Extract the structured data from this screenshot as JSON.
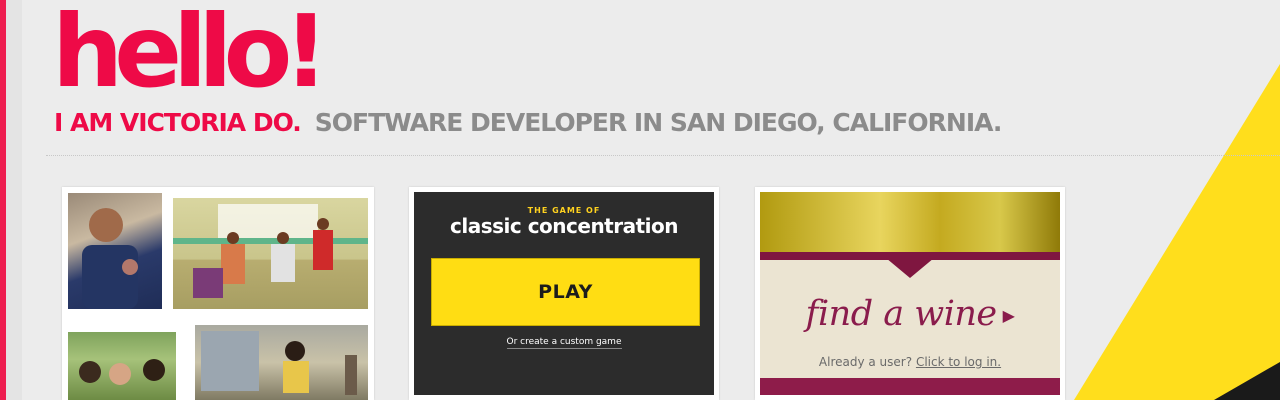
{
  "header": {
    "greeting": "hello!",
    "name": "I AM VICTORIA DO.",
    "role": "SOFTWARE DEVELOPER IN SAN DIEGO, CALIFORNIA."
  },
  "colors": {
    "accent": "#ee0a47",
    "subtle_text": "#8b8b8b",
    "background": "#ececec",
    "yellow": "#ffde1c"
  },
  "portfolio": {
    "items": [
      {
        "kind": "photo-collage"
      },
      {
        "kind": "game",
        "kicker": "THE GAME OF",
        "title": "classic concentration",
        "play_label": "PLAY",
        "link_text": "Or create a custom game"
      },
      {
        "kind": "wine-app",
        "title": "find a wine",
        "prompt": "Already a user?",
        "login_link": "Click to log in."
      }
    ]
  }
}
